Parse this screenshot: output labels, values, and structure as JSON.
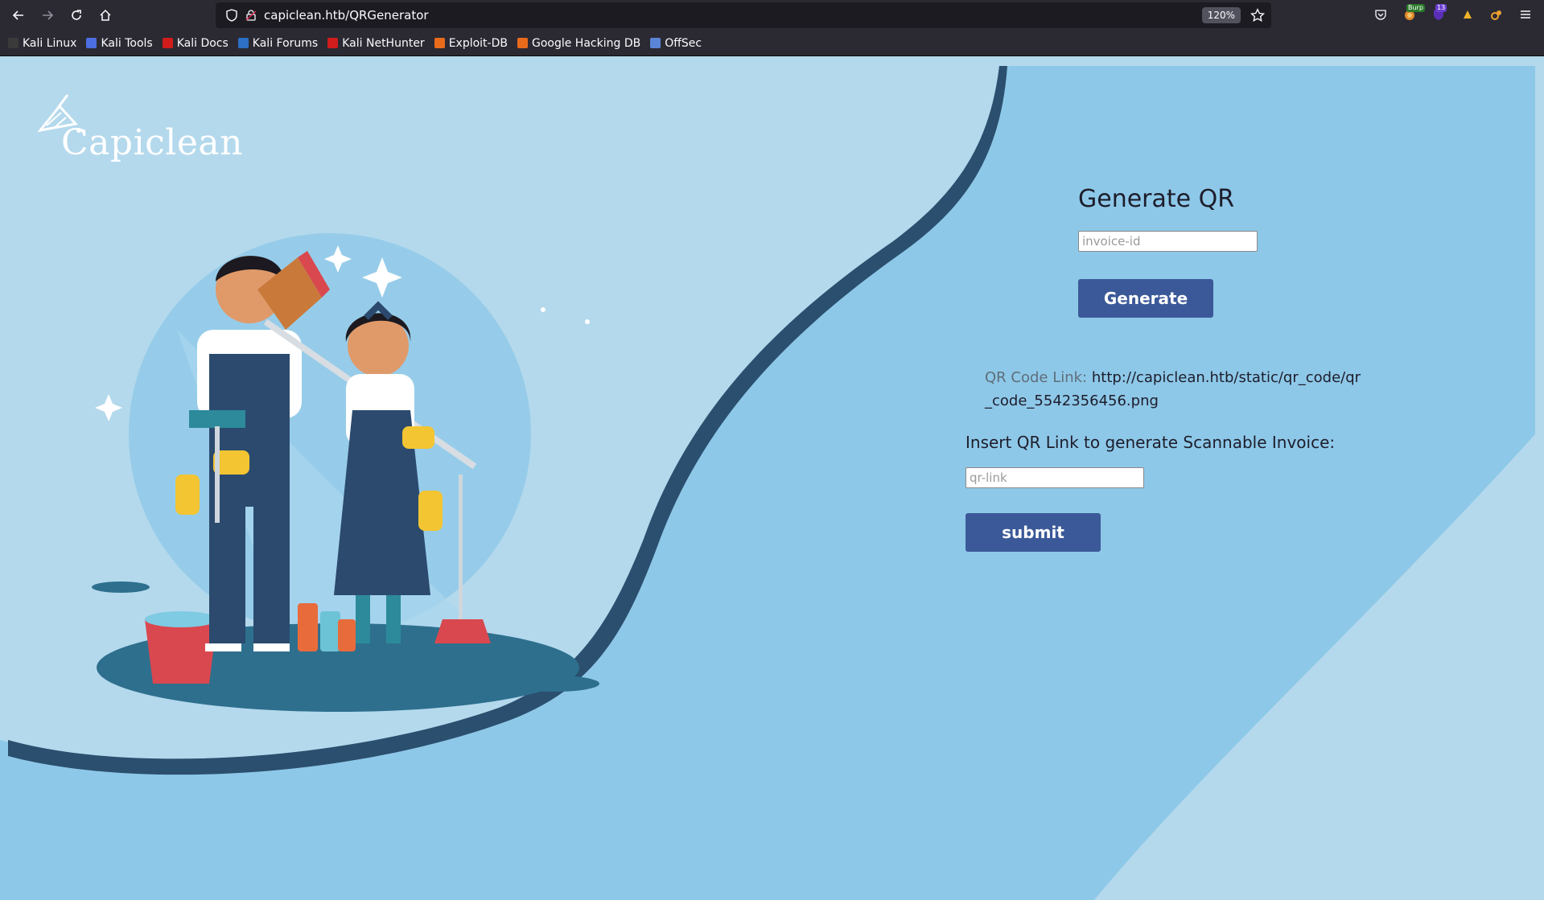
{
  "browser": {
    "url": "capiclean.htb/QRGenerator",
    "zoom": "120%",
    "extensions": [
      {
        "name": "pocket-icon"
      },
      {
        "name": "burp-icon",
        "badge": "Burp"
      },
      {
        "name": "ublock-icon",
        "badge": "13"
      },
      {
        "name": "extension-a-icon"
      },
      {
        "name": "extension-b-icon"
      }
    ]
  },
  "bookmarks": [
    {
      "label": "Kali Linux",
      "color": "#2f2f2f"
    },
    {
      "label": "Kali Tools",
      "color": "#4b6ee0"
    },
    {
      "label": "Kali Docs",
      "color": "#d11c1c"
    },
    {
      "label": "Kali Forums",
      "color": "#2c6fc4"
    },
    {
      "label": "Kali NetHunter",
      "color": "#d11c1c"
    },
    {
      "label": "Exploit-DB",
      "color": "#e86b1c"
    },
    {
      "label": "Google Hacking DB",
      "color": "#e86b1c"
    },
    {
      "label": "OffSec",
      "color": "#5a84d6"
    }
  ],
  "site": {
    "logo": "Capiclean"
  },
  "generator": {
    "title": "Generate QR",
    "invoice_placeholder": "invoice-id",
    "generate_label": "Generate",
    "qr_link_label": "QR Code Link:",
    "qr_link_value": "http://capiclean.htb/static/qr_code/qr_code_5542356456.png",
    "insert_title": "Insert QR Link to generate Scannable Invoice:",
    "qr_link_placeholder": "qr-link",
    "submit_label": "submit"
  },
  "colors": {
    "page_bg": "#b4d9ec",
    "panel_bg": "#8ec8e8",
    "button": "#3b5998"
  }
}
